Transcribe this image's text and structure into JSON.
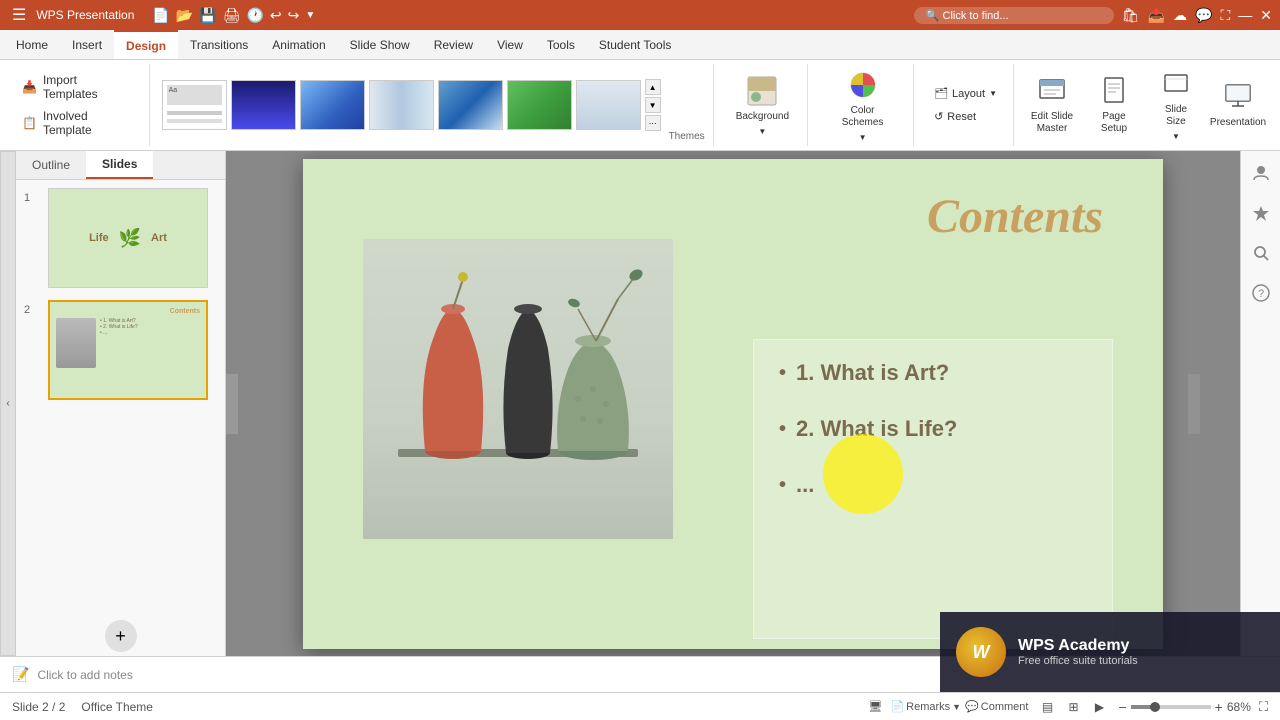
{
  "title": "WPS Presentation",
  "menu": {
    "menu_label": "Menu",
    "tabs": [
      "Home",
      "Insert",
      "Design",
      "Transitions",
      "Animation",
      "Slide Show",
      "Review",
      "View",
      "Tools",
      "Student Tools"
    ]
  },
  "ribbon": {
    "import_templates_label": "Import Templates",
    "involved_template_label": "Involved Template",
    "background_label": "Background",
    "color_schemes_label": "Color Schemes",
    "layout_label": "Layout",
    "reset_label": "Reset",
    "edit_slide_master_label": "Edit\nSlide Master",
    "page_setup_label": "Page\nSetup",
    "slide_size_label": "Slide\nSize",
    "presentation_label": "Presentation",
    "themes_label": "Themes"
  },
  "left_panel": {
    "outline_tab": "Outline",
    "slides_tab": "Slides",
    "slide1": {
      "number": "1",
      "title": "Life & Art"
    },
    "slide2": {
      "number": "2",
      "title": "Contents",
      "items": [
        "1. What is Art?",
        "2. What is Life?",
        "..."
      ]
    }
  },
  "slide": {
    "title": "Contents",
    "content_items": [
      "1. What is Art?",
      "2. What is Life?",
      "..."
    ]
  },
  "status_bar": {
    "slide_info": "Slide 2 / 2",
    "theme": "Office Theme",
    "zoom_label": "68%",
    "click_to_add_notes": "Click to add notes",
    "remarks_label": "Remarks",
    "comment_label": "Comment"
  },
  "right_panel": {
    "buttons": [
      "person-icon",
      "star-icon",
      "search-icon",
      "help-icon"
    ]
  },
  "wps_academy": {
    "title": "WPS Academy",
    "subtitle": "Free office suite tutorials",
    "logo": "W"
  }
}
